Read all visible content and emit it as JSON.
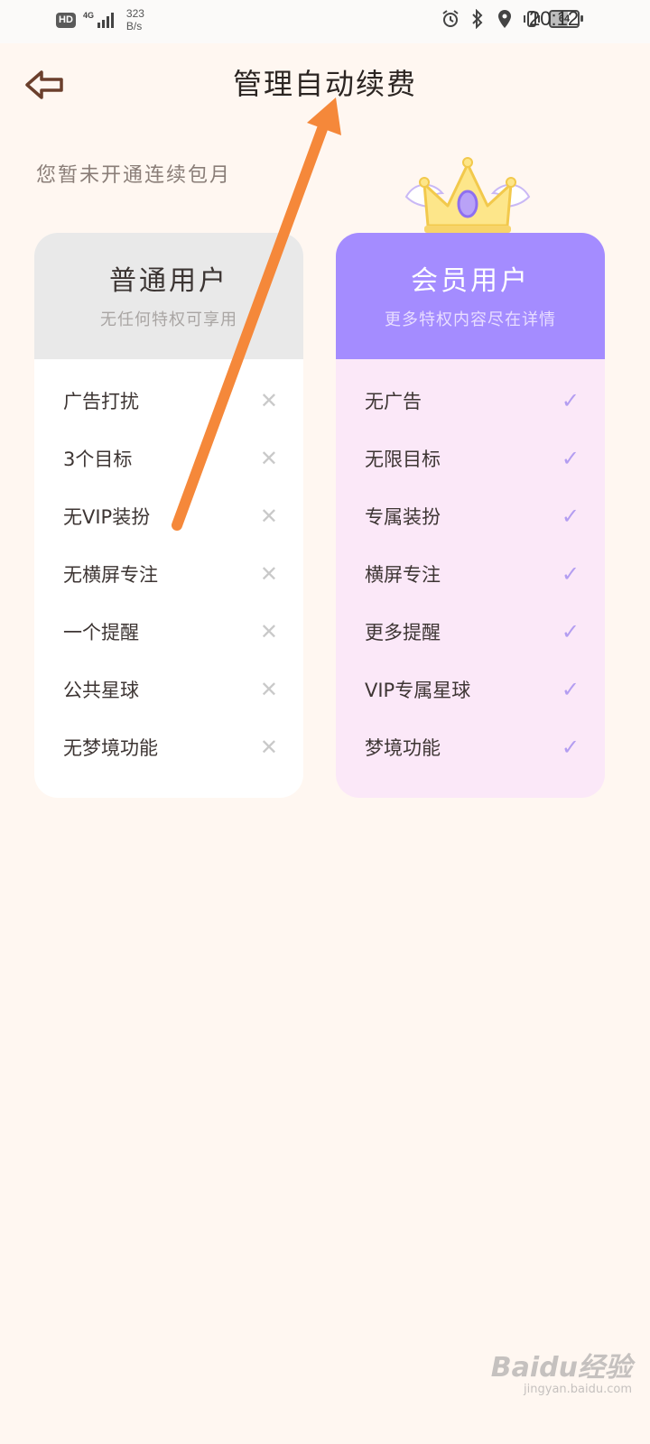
{
  "status_bar": {
    "hd_badge": "HD",
    "network": "4G",
    "speed_value": "323",
    "speed_unit": "B/s",
    "battery": "64",
    "time": "20:12",
    "icons": [
      "signal-icon",
      "alarm-icon",
      "bluetooth-icon",
      "location-icon",
      "vibrate-icon",
      "battery-icon"
    ]
  },
  "header": {
    "back_icon": "back-arrow-icon",
    "title": "管理自动续费"
  },
  "status_text": "您暂未开通连续包月",
  "plans": {
    "basic": {
      "title": "普通用户",
      "subtitle": "无任何特权可享用",
      "features": [
        "广告打扰",
        "3个目标",
        "无VIP装扮",
        "无横屏专注",
        "一个提醒",
        "公共星球",
        "无梦境功能"
      ]
    },
    "vip": {
      "title": "会员用户",
      "subtitle": "更多特权内容尽在详情",
      "features": [
        "无广告",
        "无限目标",
        "专属装扮",
        "横屏专注",
        "更多提醒",
        "VIP专属星球",
        "梦境功能"
      ]
    }
  },
  "watermark": {
    "brand": "Baidu经验",
    "url": "jingyan.baidu.com"
  },
  "colors": {
    "background": "#fff7f1",
    "vip_header": "#a48cff",
    "vip_body": "#fbe8f8",
    "basic_header": "#e9e9e9",
    "annotation_arrow": "#f5883a"
  }
}
